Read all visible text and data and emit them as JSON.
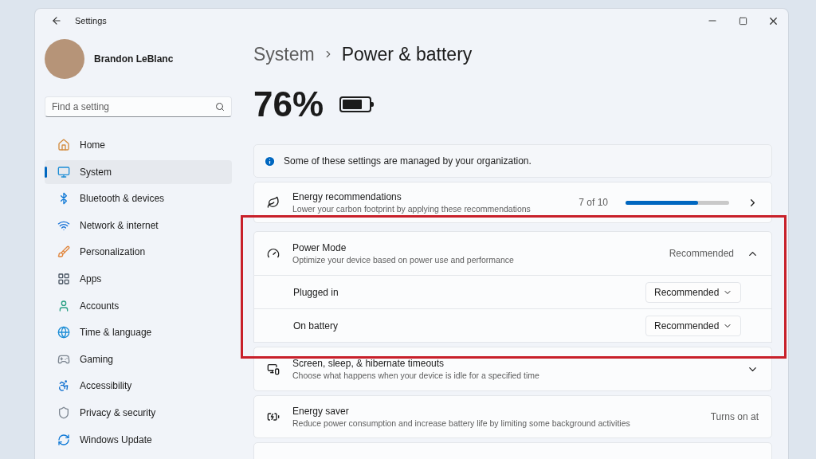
{
  "window": {
    "title": "Settings"
  },
  "profile": {
    "name": "Brandon LeBlanc"
  },
  "search": {
    "placeholder": "Find a setting"
  },
  "nav": [
    {
      "label": "Home",
      "selected": false
    },
    {
      "label": "System",
      "selected": true
    },
    {
      "label": "Bluetooth & devices",
      "selected": false
    },
    {
      "label": "Network & internet",
      "selected": false
    },
    {
      "label": "Personalization",
      "selected": false
    },
    {
      "label": "Apps",
      "selected": false
    },
    {
      "label": "Accounts",
      "selected": false
    },
    {
      "label": "Time & language",
      "selected": false
    },
    {
      "label": "Gaming",
      "selected": false
    },
    {
      "label": "Accessibility",
      "selected": false
    },
    {
      "label": "Privacy & security",
      "selected": false
    },
    {
      "label": "Windows Update",
      "selected": false
    }
  ],
  "breadcrumb": {
    "parent": "System",
    "current": "Power & battery"
  },
  "battery": {
    "percent": "76%",
    "level": 0.76
  },
  "notice": "Some of these settings are managed by your organization.",
  "energy_recommendations": {
    "title": "Energy recommendations",
    "subtitle": "Lower your carbon footprint by applying these recommendations",
    "count": "7 of 10",
    "level": 0.7
  },
  "power_mode": {
    "title": "Power Mode",
    "subtitle": "Optimize your device based on power use and performance",
    "value": "Recommended",
    "expanded": true,
    "highlighted": true,
    "options": [
      {
        "label": "Plugged in",
        "value": "Recommended"
      },
      {
        "label": "On battery",
        "value": "Recommended"
      }
    ]
  },
  "screen_sleep": {
    "title": "Screen, sleep, & hibernate timeouts",
    "subtitle": "Choose what happens when your device is idle for a specified time",
    "expanded": false
  },
  "energy_saver": {
    "title": "Energy saver",
    "subtitle": "Reduce power consumption and increase battery life by limiting some background activities",
    "value": "Turns on at"
  }
}
